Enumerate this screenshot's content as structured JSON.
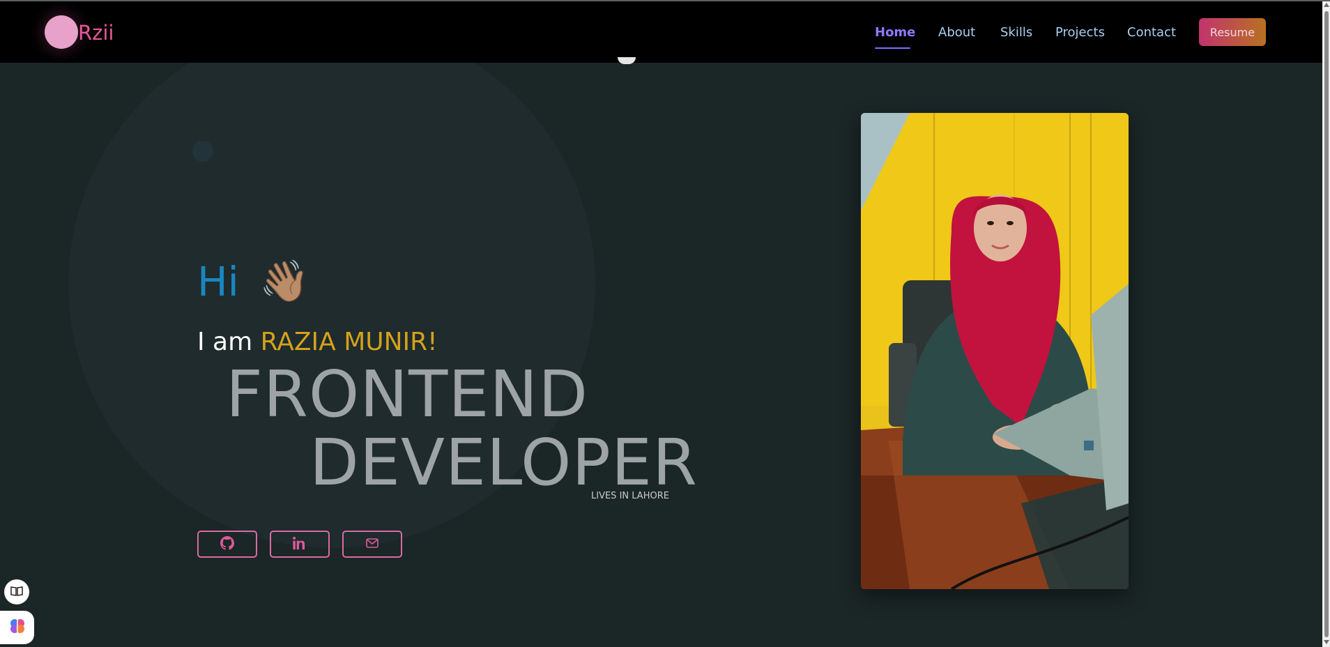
{
  "brand": {
    "name": "Rzii",
    "accent": "#e8579a",
    "logo_circle_color": "#e8a1c9"
  },
  "nav": {
    "items": [
      {
        "label": "Home",
        "active": true
      },
      {
        "label": "About",
        "active": false
      },
      {
        "label": "Skills",
        "active": false
      },
      {
        "label": "Projects",
        "active": false
      },
      {
        "label": "Contact",
        "active": false
      }
    ],
    "resume_label": "Resume",
    "active_color": "#8d7bff",
    "link_color": "#a8d0f2"
  },
  "hero": {
    "greeting": "Hi",
    "wave_emoji": "👋🏽",
    "intro_prefix": "I am",
    "name": "RAZIA MUNIR!",
    "title_line1": "FRONTEND",
    "title_line2": "DEVELOPER",
    "location": "LIVES IN LAHORE",
    "name_color": "#d4a21b",
    "greeting_color": "#1a86c0"
  },
  "social": [
    {
      "icon": "github-icon"
    },
    {
      "icon": "linkedin-icon"
    },
    {
      "icon": "mail-icon"
    }
  ],
  "photo": {
    "description_icon": "profile-photo"
  },
  "widgets": [
    {
      "icon": "book-icon"
    },
    {
      "icon": "brain-icon"
    }
  ],
  "colors": {
    "background": "#1b2627",
    "navbar": "#000000",
    "title_gray": "#9ea3a5",
    "social_border": "#d96aa4"
  }
}
